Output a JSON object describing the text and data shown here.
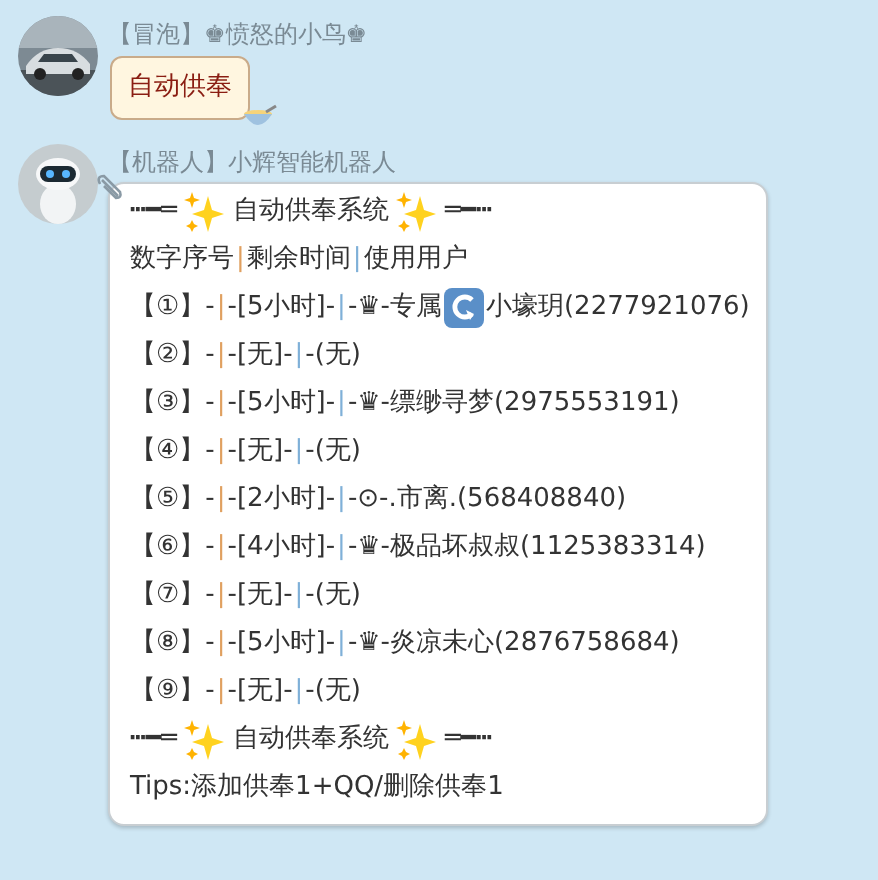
{
  "messages": [
    {
      "sender": "【冒泡】♚愤怒的小鸟♚",
      "kind": "user",
      "bubble_text": "自动供奉"
    },
    {
      "sender": "【机器人】小辉智能机器人",
      "kind": "robot",
      "lines": [
        [
          {
            "kind": "text",
            "text": "┅━═"
          },
          {
            "kind": "sparkle"
          },
          {
            "kind": "text",
            "text": "自动供奉系统"
          },
          {
            "kind": "sparkle"
          },
          {
            "kind": "text",
            "text": "═━┅"
          }
        ],
        [
          {
            "kind": "text",
            "text": "数字序号"
          },
          {
            "kind": "pipe",
            "text": "|",
            "color": "#e0a060"
          },
          {
            "kind": "text",
            "text": "剩余时间"
          },
          {
            "kind": "pipe",
            "text": "|",
            "color": "#7fb0d8"
          },
          {
            "kind": "text",
            "text": "使用用户"
          }
        ],
        [
          {
            "kind": "text",
            "text": "【①】-"
          },
          {
            "kind": "pipe",
            "text": "|",
            "color": "#e0a060"
          },
          {
            "kind": "text",
            "text": "-[5小时]-"
          },
          {
            "kind": "pipe",
            "text": "|",
            "color": "#7fb0d8"
          },
          {
            "kind": "text",
            "text": "-♛-专属"
          },
          {
            "kind": "replay"
          },
          {
            "kind": "text",
            "text": "小壕玥(2277921076)"
          }
        ],
        [
          {
            "kind": "text",
            "text": "【②】-"
          },
          {
            "kind": "pipe",
            "text": "|",
            "color": "#e0a060"
          },
          {
            "kind": "text",
            "text": "-[无]-"
          },
          {
            "kind": "pipe",
            "text": "|",
            "color": "#7fb0d8"
          },
          {
            "kind": "text",
            "text": "-(无)"
          }
        ],
        [
          {
            "kind": "text",
            "text": "【③】-"
          },
          {
            "kind": "pipe",
            "text": "|",
            "color": "#e0a060"
          },
          {
            "kind": "text",
            "text": "-[5小时]-"
          },
          {
            "kind": "pipe",
            "text": "|",
            "color": "#7fb0d8"
          },
          {
            "kind": "text",
            "text": "-♛-缥缈寻梦(2975553191)"
          }
        ],
        [
          {
            "kind": "text",
            "text": "【④】-"
          },
          {
            "kind": "pipe",
            "text": "|",
            "color": "#e0a060"
          },
          {
            "kind": "text",
            "text": "-[无]-"
          },
          {
            "kind": "pipe",
            "text": "|",
            "color": "#7fb0d8"
          },
          {
            "kind": "text",
            "text": "-(无)"
          }
        ],
        [
          {
            "kind": "text",
            "text": "【⑤】-"
          },
          {
            "kind": "pipe",
            "text": "|",
            "color": "#e0a060"
          },
          {
            "kind": "text",
            "text": "-[2小时]-"
          },
          {
            "kind": "pipe",
            "text": "|",
            "color": "#7fb0d8"
          },
          {
            "kind": "text",
            "text": "-⊙-.市离.(568408840)"
          }
        ],
        [
          {
            "kind": "text",
            "text": "【⑥】-"
          },
          {
            "kind": "pipe",
            "text": "|",
            "color": "#e0a060"
          },
          {
            "kind": "text",
            "text": "-[4小时]-"
          },
          {
            "kind": "pipe",
            "text": "|",
            "color": "#7fb0d8"
          },
          {
            "kind": "text",
            "text": "-♛-极品坏叔叔(1125383314)"
          }
        ],
        [
          {
            "kind": "text",
            "text": "【⑦】-"
          },
          {
            "kind": "pipe",
            "text": "|",
            "color": "#e0a060"
          },
          {
            "kind": "text",
            "text": "-[无]-"
          },
          {
            "kind": "pipe",
            "text": "|",
            "color": "#7fb0d8"
          },
          {
            "kind": "text",
            "text": "-(无)"
          }
        ],
        [
          {
            "kind": "text",
            "text": "【⑧】-"
          },
          {
            "kind": "pipe",
            "text": "|",
            "color": "#e0a060"
          },
          {
            "kind": "text",
            "text": "-[5小时]-"
          },
          {
            "kind": "pipe",
            "text": "|",
            "color": "#7fb0d8"
          },
          {
            "kind": "text",
            "text": "-♛-炎凉未心(2876758684)"
          }
        ],
        [
          {
            "kind": "text",
            "text": "【⑨】-"
          },
          {
            "kind": "pipe",
            "text": "|",
            "color": "#e0a060"
          },
          {
            "kind": "text",
            "text": "-[无]-"
          },
          {
            "kind": "pipe",
            "text": "|",
            "color": "#7fb0d8"
          },
          {
            "kind": "text",
            "text": "-(无)"
          }
        ],
        [
          {
            "kind": "text",
            "text": "┅━═"
          },
          {
            "kind": "sparkle"
          },
          {
            "kind": "text",
            "text": "自动供奉系统"
          },
          {
            "kind": "sparkle"
          },
          {
            "kind": "text",
            "text": "═━┅"
          }
        ],
        [
          {
            "kind": "text",
            "text": "Tips:添加供奉1+QQ/删除供奉1"
          }
        ]
      ]
    }
  ]
}
